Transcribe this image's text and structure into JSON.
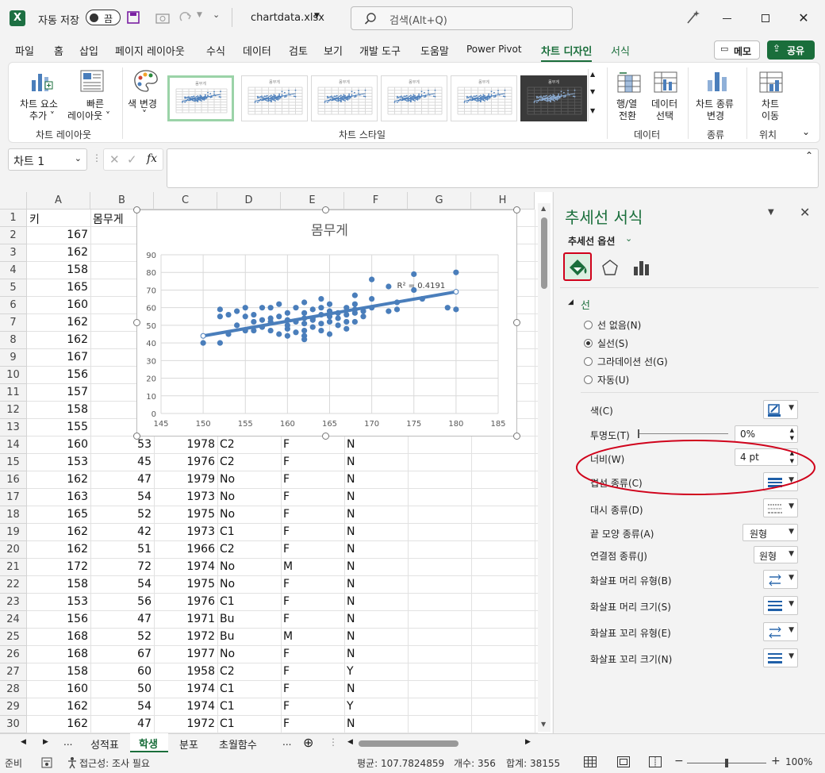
{
  "titlebar": {
    "autosave_label": "자동 저장",
    "toggle_label": "끔",
    "filename": "chartdata.xlsx",
    "search_placeholder": "검색(Alt+Q)"
  },
  "menu": {
    "items": [
      "파일",
      "홈",
      "삽입",
      "페이지 레이아웃",
      "수식",
      "데이터",
      "검토",
      "보기",
      "개발 도구",
      "도움말",
      "Power Pivot",
      "차트 디자인",
      "서식"
    ],
    "active": "차트 디자인",
    "memo": "메모",
    "share": "공유"
  },
  "ribbon": {
    "add_element": [
      "차트 요소",
      "추가 ˅"
    ],
    "quick_layout": [
      "빠른",
      "레이아웃 ˅"
    ],
    "change_colors": [
      "색 변경",
      "˅"
    ],
    "switch_row_col": [
      "행/열",
      "전환"
    ],
    "select_data": [
      "데이터",
      "선택"
    ],
    "change_type": [
      "차트 종류",
      "변경"
    ],
    "move_chart": [
      "차트",
      "이동"
    ],
    "groups": {
      "layouts": "차트 레이아웃",
      "styles": "차트 스타일",
      "data": "데이터",
      "type": "종류",
      "location": "위치"
    },
    "thumb_title": "몸무게"
  },
  "formula": {
    "name_box": "차트 1",
    "fx": "fx"
  },
  "grid": {
    "columns": [
      "A",
      "B",
      "C",
      "D",
      "E",
      "F",
      "G",
      "H"
    ],
    "rows": [
      {
        "n": "1",
        "a": "키",
        "b": "몸무게",
        "c": "",
        "d": "",
        "e": "",
        "f": ""
      },
      {
        "n": "2",
        "a": "167",
        "b": "",
        "c": "",
        "d": "",
        "e": "",
        "f": ""
      },
      {
        "n": "3",
        "a": "162",
        "b": "",
        "c": "",
        "d": "",
        "e": "",
        "f": ""
      },
      {
        "n": "4",
        "a": "158",
        "b": "",
        "c": "",
        "d": "",
        "e": "",
        "f": ""
      },
      {
        "n": "5",
        "a": "165",
        "b": "",
        "c": "",
        "d": "",
        "e": "",
        "f": ""
      },
      {
        "n": "6",
        "a": "160",
        "b": "",
        "c": "",
        "d": "",
        "e": "",
        "f": ""
      },
      {
        "n": "7",
        "a": "162",
        "b": "",
        "c": "",
        "d": "",
        "e": "",
        "f": ""
      },
      {
        "n": "8",
        "a": "162",
        "b": "",
        "c": "",
        "d": "",
        "e": "",
        "f": ""
      },
      {
        "n": "9",
        "a": "167",
        "b": "",
        "c": "",
        "d": "",
        "e": "",
        "f": ""
      },
      {
        "n": "10",
        "a": "156",
        "b": "",
        "c": "",
        "d": "",
        "e": "",
        "f": ""
      },
      {
        "n": "11",
        "a": "157",
        "b": "",
        "c": "",
        "d": "",
        "e": "",
        "f": ""
      },
      {
        "n": "12",
        "a": "158",
        "b": "",
        "c": "",
        "d": "",
        "e": "",
        "f": ""
      },
      {
        "n": "13",
        "a": "155",
        "b": "",
        "c": "",
        "d": "",
        "e": "",
        "f": ""
      },
      {
        "n": "14",
        "a": "160",
        "b": "53",
        "c": "1978",
        "d": "C2",
        "e": "F",
        "f": "N"
      },
      {
        "n": "15",
        "a": "153",
        "b": "45",
        "c": "1976",
        "d": "C2",
        "e": "F",
        "f": "N"
      },
      {
        "n": "16",
        "a": "162",
        "b": "47",
        "c": "1979",
        "d": "No",
        "e": "F",
        "f": "N"
      },
      {
        "n": "17",
        "a": "163",
        "b": "54",
        "c": "1973",
        "d": "No",
        "e": "F",
        "f": "N"
      },
      {
        "n": "18",
        "a": "165",
        "b": "52",
        "c": "1975",
        "d": "No",
        "e": "F",
        "f": "N"
      },
      {
        "n": "19",
        "a": "162",
        "b": "42",
        "c": "1973",
        "d": "C1",
        "e": "F",
        "f": "N"
      },
      {
        "n": "20",
        "a": "162",
        "b": "51",
        "c": "1966",
        "d": "C2",
        "e": "F",
        "f": "N"
      },
      {
        "n": "21",
        "a": "172",
        "b": "72",
        "c": "1974",
        "d": "No",
        "e": "M",
        "f": "N"
      },
      {
        "n": "22",
        "a": "158",
        "b": "54",
        "c": "1975",
        "d": "No",
        "e": "F",
        "f": "N"
      },
      {
        "n": "23",
        "a": "153",
        "b": "56",
        "c": "1976",
        "d": "C1",
        "e": "F",
        "f": "N"
      },
      {
        "n": "24",
        "a": "156",
        "b": "47",
        "c": "1971",
        "d": "Bu",
        "e": "F",
        "f": "N"
      },
      {
        "n": "25",
        "a": "168",
        "b": "52",
        "c": "1972",
        "d": "Bu",
        "e": "M",
        "f": "N"
      },
      {
        "n": "26",
        "a": "168",
        "b": "67",
        "c": "1977",
        "d": "No",
        "e": "F",
        "f": "N"
      },
      {
        "n": "27",
        "a": "158",
        "b": "60",
        "c": "1958",
        "d": "C2",
        "e": "F",
        "f": "Y"
      },
      {
        "n": "28",
        "a": "160",
        "b": "50",
        "c": "1974",
        "d": "C1",
        "e": "F",
        "f": "N"
      },
      {
        "n": "29",
        "a": "162",
        "b": "54",
        "c": "1974",
        "d": "C1",
        "e": "F",
        "f": "Y"
      },
      {
        "n": "30",
        "a": "162",
        "b": "47",
        "c": "1972",
        "d": "C1",
        "e": "F",
        "f": "N"
      }
    ]
  },
  "chart_data": {
    "type": "scatter",
    "title": "몸무게",
    "xlim": [
      145,
      185
    ],
    "ylim": [
      0,
      90
    ],
    "xticks": [
      "145",
      "150",
      "155",
      "160",
      "165",
      "170",
      "175",
      "180",
      "185"
    ],
    "yticks": [
      "0",
      "10",
      "20",
      "30",
      "40",
      "50",
      "60",
      "70",
      "80",
      "90"
    ],
    "grid": true,
    "trendline": {
      "x": [
        150,
        180
      ],
      "y": [
        44,
        69
      ],
      "label": "R² = 0.4191"
    },
    "series": [
      {
        "color": "#4a7ebb",
        "points": [
          [
            150,
            40
          ],
          [
            152,
            55
          ],
          [
            152,
            59
          ],
          [
            152,
            40
          ],
          [
            153,
            45
          ],
          [
            153,
            56
          ],
          [
            154,
            50
          ],
          [
            154,
            58
          ],
          [
            155,
            60
          ],
          [
            155,
            47
          ],
          [
            155,
            55
          ],
          [
            156,
            47
          ],
          [
            156,
            52
          ],
          [
            156,
            56
          ],
          [
            157,
            53
          ],
          [
            157,
            49
          ],
          [
            157,
            60
          ],
          [
            158,
            54
          ],
          [
            158,
            60
          ],
          [
            158,
            47
          ],
          [
            158,
            52
          ],
          [
            159,
            55
          ],
          [
            159,
            45
          ],
          [
            159,
            62
          ],
          [
            160,
            53
          ],
          [
            160,
            50
          ],
          [
            160,
            48
          ],
          [
            160,
            57
          ],
          [
            160,
            44
          ],
          [
            161,
            52
          ],
          [
            161,
            60
          ],
          [
            161,
            46
          ],
          [
            162,
            47
          ],
          [
            162,
            42
          ],
          [
            162,
            51
          ],
          [
            162,
            54
          ],
          [
            162,
            57
          ],
          [
            162,
            63
          ],
          [
            162,
            44
          ],
          [
            163,
            54
          ],
          [
            163,
            49
          ],
          [
            163,
            59
          ],
          [
            163,
            53
          ],
          [
            164,
            56
          ],
          [
            164,
            47
          ],
          [
            164,
            51
          ],
          [
            164,
            60
          ],
          [
            164,
            65
          ],
          [
            165,
            52
          ],
          [
            165,
            58
          ],
          [
            165,
            55
          ],
          [
            165,
            45
          ],
          [
            165,
            62
          ],
          [
            166,
            54
          ],
          [
            166,
            50
          ],
          [
            166,
            57
          ],
          [
            167,
            56
          ],
          [
            167,
            52
          ],
          [
            167,
            60
          ],
          [
            167,
            48
          ],
          [
            168,
            52
          ],
          [
            168,
            67
          ],
          [
            168,
            57
          ],
          [
            168,
            59
          ],
          [
            168,
            62
          ],
          [
            169,
            58
          ],
          [
            169,
            55
          ],
          [
            170,
            65
          ],
          [
            170,
            60
          ],
          [
            170,
            76
          ],
          [
            172,
            72
          ],
          [
            172,
            58
          ],
          [
            173,
            63
          ],
          [
            173,
            59
          ],
          [
            175,
            70
          ],
          [
            175,
            79
          ],
          [
            176,
            65
          ],
          [
            179,
            60
          ],
          [
            180,
            59
          ],
          [
            180,
            80
          ]
        ]
      }
    ]
  },
  "pane": {
    "title": "추세선 서식",
    "subtitle": "추세선 옵션",
    "section": "선",
    "radios": [
      {
        "label": "선 없음(N)",
        "checked": false
      },
      {
        "label": "실선(S)",
        "checked": true
      },
      {
        "label": "그라데이션 선(G)",
        "checked": false
      },
      {
        "label": "자동(U)",
        "checked": false
      }
    ],
    "color_label": "색(C)",
    "transparency_label": "투명도(T)",
    "transparency_value": "0%",
    "width_label": "너비(W)",
    "width_value": "4 pt",
    "compound_label": "겹선 종류(C)",
    "dash_label": "대시 종류(D)",
    "cap_label": "끝 모양 종류(A)",
    "cap_value": "원형",
    "join_label": "연결점 종류(J)",
    "join_value": "원형",
    "arrow_begin_type": "화살표 머리 유형(B)",
    "arrow_begin_size": "화살표 머리 크기(S)",
    "arrow_end_type": "화살표 꼬리 유형(E)",
    "arrow_end_size": "화살표 꼬리 크기(N)"
  },
  "sheets": {
    "tabs": [
      "성적표",
      "학생",
      "분포",
      "초월함수"
    ],
    "active": "학생",
    "ellipsis": "...",
    "add": "⊕"
  },
  "status": {
    "ready": "준비",
    "accessibility": "접근성: 조사 필요",
    "average": "평균: 107.7824859",
    "count": "개수: 356",
    "sum": "합계: 38155",
    "zoom": "100%"
  },
  "colors": {
    "accent": "#1a6e3b",
    "series": "#4a7ebb",
    "highlight": "#d0021b"
  }
}
